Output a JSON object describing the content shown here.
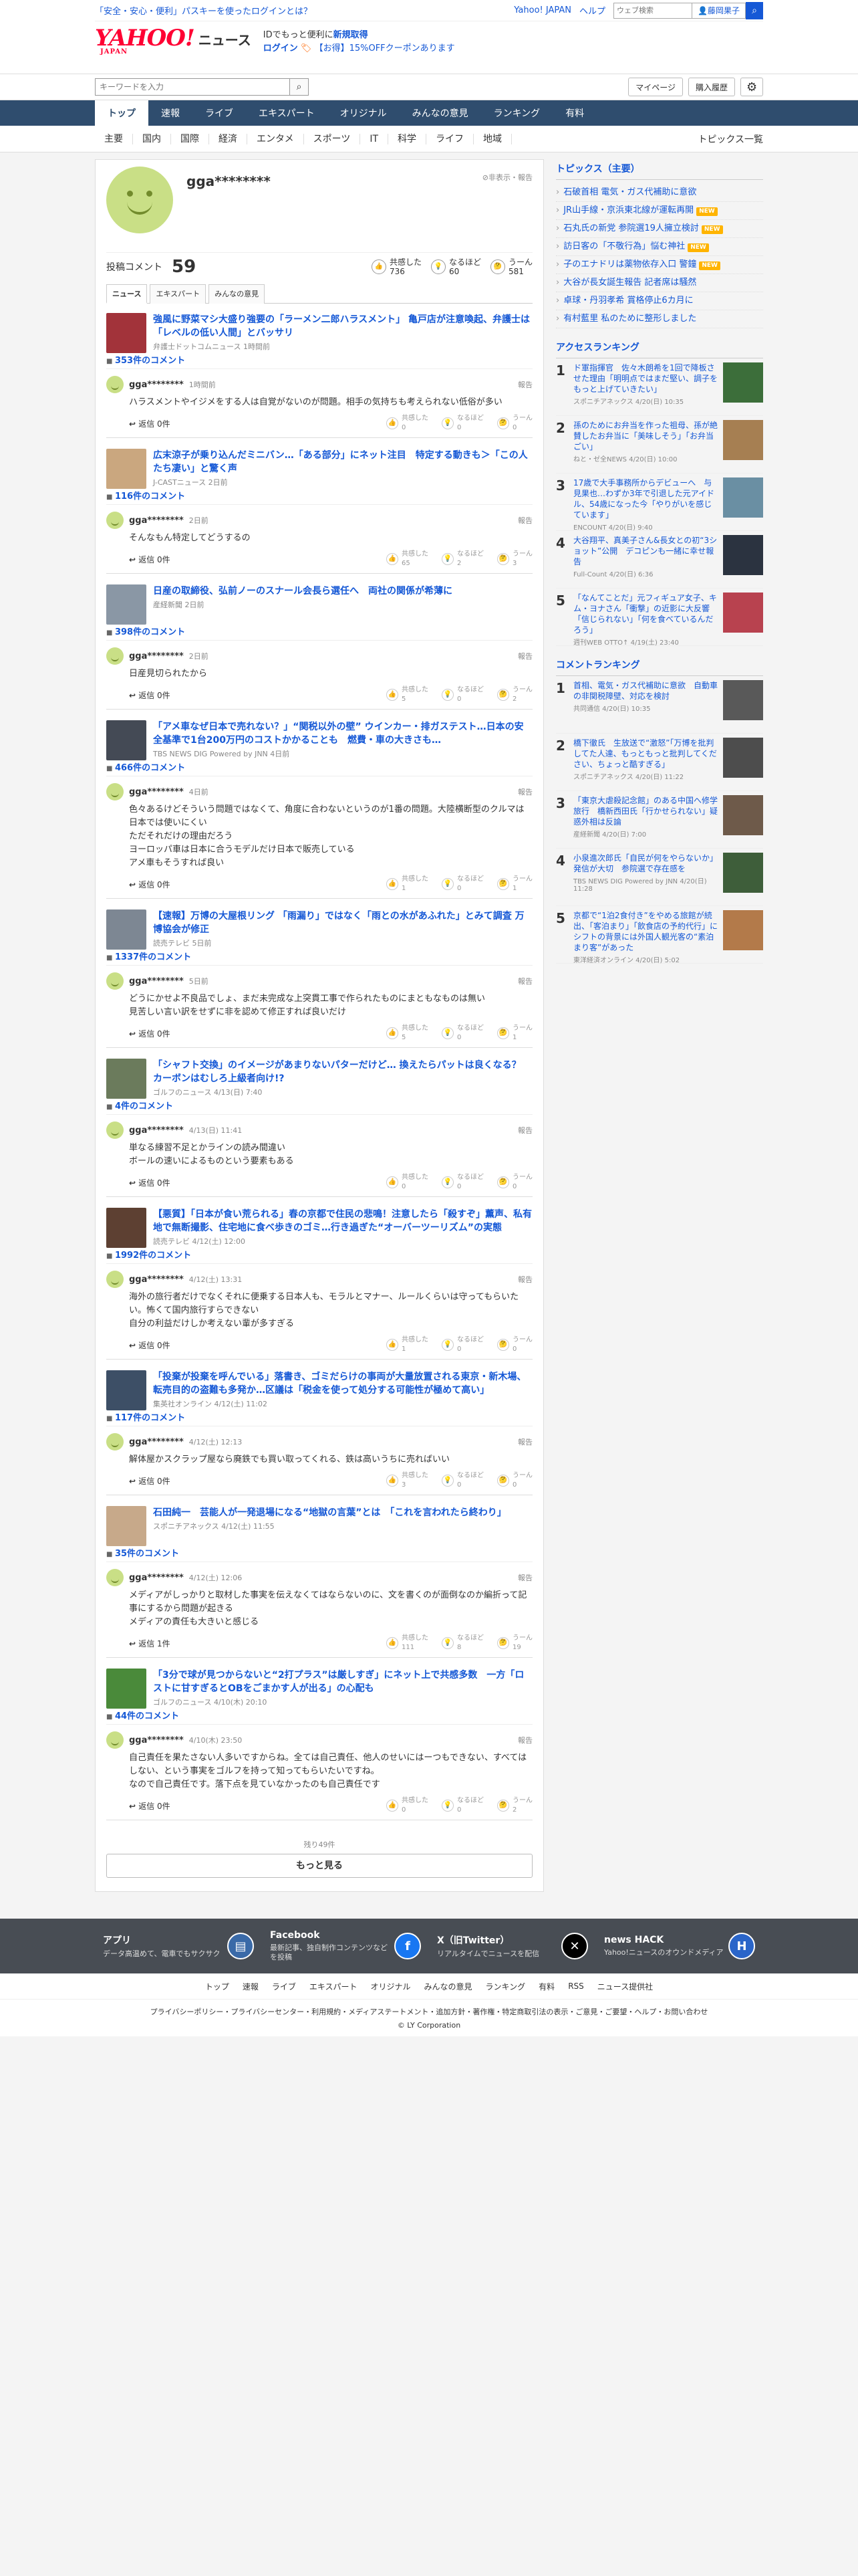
{
  "header": {
    "promo": "「安全・安心・便利」パスキーを使ったログインとは？",
    "links": [
      "Yahoo! JAPAN",
      "ヘルプ"
    ],
    "web_search_placeholder": "ウェブ検索",
    "user_button": "藤岡果子",
    "search_icon": "magnifier-icon",
    "logo_text": "YAHOO!",
    "logo_sub": "JAPAN",
    "news_title": "ニュース",
    "brand_msg": "IDでもっと便利に",
    "signup": "新規取得",
    "login": "ログイン",
    "coupon": "【お得】15%OFFクーポンあります"
  },
  "searchbar": {
    "placeholder": "キーワードを入力",
    "mypage": "マイページ",
    "history": "購入履歴",
    "gear": "gear-icon"
  },
  "nav": {
    "items": [
      "トップ",
      "速報",
      "ライブ",
      "エキスパート",
      "オリジナル",
      "みんなの意見",
      "ランキング",
      "有料"
    ],
    "active": 0
  },
  "subnav": {
    "items": [
      "主要",
      "国内",
      "国際",
      "経済",
      "エンタメ",
      "スポーツ",
      "IT",
      "科学",
      "ライフ",
      "地域"
    ],
    "right": "トピックス一覧"
  },
  "profile": {
    "name": "gga********",
    "report": "非表示・報告",
    "posts_label": "投稿コメント",
    "posts": "59",
    "reactions": [
      {
        "icon": "thumb-icon",
        "label": "共感した",
        "value": "736"
      },
      {
        "icon": "lightbulb-icon",
        "label": "なるほど",
        "value": "60"
      },
      {
        "icon": "thinking-icon",
        "label": "うーん",
        "value": "581"
      }
    ],
    "tabs": [
      "ニュース",
      "エキスパート",
      "みんなの意見"
    ]
  },
  "rx_labels": [
    "共感した",
    "なるほど",
    "うーん"
  ],
  "reply_label": "返信",
  "report_label": "報告",
  "items": [
    {
      "title": "強風に野菜マシ大盛り強要の「ラーメン二郎ハラスメント」 亀戸店が注意喚起、弁護士は「レベルの低い人間」とバッサリ",
      "src": "弁護士ドットコムニュース 1時間前",
      "count": "353件のコメント",
      "name": "gga********",
      "time": "1時間前",
      "text": "ハラスメントやイジメをする人は自覚がないのが問題。相手の気持ちも考えられない低俗が多い",
      "reply": "返信 0件",
      "r": [
        "0",
        "0",
        "0"
      ],
      "color": "#a2333a"
    },
    {
      "title": "広末涼子が乗り込んだミニバン…「ある部分」にネット注目　特定する動きも＞「この人たち凄い」と驚く声",
      "src": "J-CASTニュース 2日前",
      "count": "116件のコメント",
      "name": "gga********",
      "time": "2日前",
      "text": "そんなもん特定してどうするの",
      "reply": "返信 0件",
      "r": [
        "65",
        "2",
        "3"
      ],
      "color": "#caa77f"
    },
    {
      "title": "日産の取締役、弘前ノーのスナール会長ら選任へ　両社の関係が希薄に",
      "src": "産経新聞 2日前",
      "count": "398件のコメント",
      "name": "gga********",
      "time": "2日前",
      "text": "日産見切られたから",
      "reply": "返信 0件",
      "r": [
        "5",
        "0",
        "2"
      ],
      "color": "#8a97a5"
    },
    {
      "title": "「アメ車なぜ日本で売れない？」“関税以外の壁” ウインカー・排ガステスト…日本の安全基準で1台200万円のコストかかることも　燃費・車の大きさも…",
      "src": "TBS NEWS DIG Powered by JNN 4日前",
      "count": "466件のコメント",
      "name": "gga********",
      "time": "4日前",
      "text": "色々あるけどそういう問題ではなくて、角度に合わないというのが1番の問題。大陸横断型のクルマは日本では使いにくい\nただそれだけの理由だろう\nヨーロッパ車は日本に合うモデルだけ日本で販売している\nアメ車もそうすれば良い",
      "reply": "返信 0件",
      "r": [
        "1",
        "0",
        "1"
      ],
      "color": "#444a55"
    },
    {
      "title": "【速報】万博の大屋根リング 「雨漏り」ではなく「雨との水があふれた」とみて調査 万博協会が修正",
      "src": "読売テレビ 5日前",
      "count": "1337件のコメント",
      "name": "gga********",
      "time": "5日前",
      "text": "どうにかせよ不良品でしょ、まだ未完成な上突貫工事で作られたものにまともなものは無い\n見苦しい言い訳をせずに非を認めて修正すれば良いだけ",
      "reply": "返信 0件",
      "r": [
        "5",
        "0",
        "1"
      ],
      "color": "#7d8793"
    },
    {
      "title": "「シャフト交換」のイメージがあまりないパターだけど… 換えたらパットは良くなる？ カーボンはむしろ上級者向け!?",
      "src": "ゴルフのニュース 4/13(日) 7:40",
      "count": "4件のコメント",
      "name": "gga********",
      "time": "4/13(日) 11:41",
      "text": "単なる練習不足とかラインの読み間違い\nボールの速いによるものという要素もある",
      "reply": "返信 0件",
      "r": [
        "0",
        "0",
        "0"
      ],
      "color": "#6b7b5c"
    },
    {
      "title": "【悪質】「日本が食い荒られる」春の京都で住民の悲鳴！注意したら「殺すぞ」薫声、私有地で無断撮影、住宅地に食べ歩きのゴミ…行き過ぎた“オーバーツーリズム”の実態",
      "src": "読売テレビ 4/12(土) 12:00",
      "count": "1992件のコメント",
      "name": "gga********",
      "time": "4/12(土) 13:31",
      "text": "海外の旅行者だけでなくそれに便乗する日本人も、モラルとマナー、ルールくらいは守ってもらいたい。怖くて国内旅行すらできない\n自分の利益だけしか考えない輩が多すぎる",
      "reply": "返信 0件",
      "r": [
        "1",
        "0",
        "0"
      ],
      "color": "#5d4032"
    },
    {
      "title": "「投棄が投棄を呼んでいる」落書き、ゴミだらけの事両が大量放置される東京・新木場、転売目的の盗難も多発か…区議は「税金を使って処分する可能性が極めて高い」",
      "src": "集英社オンライン 4/12(土) 11:02",
      "count": "117件のコメント",
      "name": "gga********",
      "time": "4/12(土) 12:13",
      "text": "解体屋かスクラップ屋なら廃鉄でも買い取ってくれる、鉄は高いうちに売ればいい",
      "reply": "返信 0件",
      "r": [
        "3",
        "0",
        "0"
      ],
      "color": "#3d4f66"
    },
    {
      "title": "石田純一　芸能人が一発退場になる“地獄の言葉”とは　「これを言われたら終わり」",
      "src": "スポニチアネックス 4/12(土) 11:55",
      "count": "35件のコメント",
      "name": "gga********",
      "time": "4/12(土) 12:06",
      "text": "メディアがしっかりと取材した事実を伝えなくてはならないのに、文を書くのが面倒なのか編折って記事にするから問題が起きる\nメディアの責任も大きいと感じる",
      "reply": "返信 1件",
      "r": [
        "111",
        "8",
        "19"
      ],
      "color": "#c7a98a"
    },
    {
      "title": "「3分で球が見つからないと“2打プラス”は厳しすぎ」にネット上で共感多数　一方「ロストに甘すぎるとOBをごまかす人が出る」の心配も",
      "src": "ゴルフのニュース 4/10(木) 20:10",
      "count": "44件のコメント",
      "name": "gga********",
      "time": "4/10(木) 23:50",
      "text": "自己責任を果たさない人多いですからね。全ては自己責任、他人のせいにはーつもできない、すべてはしない、という事実をゴルフを持って知ってもらいたいですね。\nなので自己責任です。落下点を見ていなかったのも自己責任です",
      "reply": "返信 0件",
      "r": [
        "0",
        "0",
        "2"
      ],
      "color": "#4a8a3a"
    }
  ],
  "more": {
    "remain": "残り49件",
    "label": "もっと見る"
  },
  "topics": {
    "title": "トピックス（主要）",
    "items": [
      {
        "t": "石破首相 電気・ガス代補助に意欲",
        "b": ""
      },
      {
        "t": "JR山手線・京浜東北線が運転再開",
        "b": "NEW"
      },
      {
        "t": "石丸氏の新党 参院選19人擁立検討",
        "b": "NEW"
      },
      {
        "t": "訪日客の「不敬行為」悩む神社",
        "b": "NEW"
      },
      {
        "t": "子のエナドリは薬物依存入口 警鐘",
        "b": "NEW"
      },
      {
        "t": "大谷が長女誕生報告 記者席は騒然",
        "b": ""
      },
      {
        "t": "卓球・丹羽孝希 賞格停止6カ月に",
        "b": ""
      },
      {
        "t": "有村藍里 私のために整形しました",
        "b": ""
      }
    ]
  },
  "access": {
    "title": "アクセスランキング",
    "items": [
      {
        "n": "1",
        "t": "ド軍指揮官　佐々木朗希を1回で降板させた理由「明明点ではまだ堅い、調子をもっと上げていきたい」",
        "s": "スポニチアネックス 4/20(日) 10:35",
        "c": "#3c6e3a"
      },
      {
        "n": "2",
        "t": "孫のためにお弁当を作った祖母、孫が絶賛したお弁当に「美味しそう」「お弁当ごい」",
        "s": "ねと・ゼ全NEWS 4/20(日) 10:00",
        "c": "#a67f52"
      },
      {
        "n": "3",
        "t": "17歳で大手事務所からデビューへ　与見果也…わずか3年で引退した元アイドル、54歳になった今「やりがいを感じています」",
        "s": "ENCOUNT 4/20(日) 9:40",
        "c": "#6a8fa3"
      },
      {
        "n": "4",
        "t": "大谷翔平、真美子さん&長女との初“3ショット”公開　デコピンも一緒に幸せ報告",
        "s": "Full-Count 4/20(日) 6:36",
        "c": "#2b3340"
      },
      {
        "n": "5",
        "t": "「なんてことだ」元フィギュア女子、キム・ヨナさん「衝撃」の近影に大反響「信じられない」「何を食べているんだろう」",
        "s": "週刊WEB OTTO↑ 4/19(土) 23:40",
        "c": "#b8424f"
      }
    ]
  },
  "commentrank": {
    "title": "コメントランキング",
    "items": [
      {
        "n": "1",
        "t": "首相、電気・ガス代補助に意欲　自動車の非関税障壁、対応を検討",
        "s": "共同通信 4/20(日) 10:35",
        "c": "#595959"
      },
      {
        "n": "2",
        "t": "橋下徹氏　生放送で“激怒”「万博を批判してた人達、もっともっと批判してください、ちょっと酷すぎる」",
        "s": "スポニチアネックス 4/20(日) 11:22",
        "c": "#4d4d4d"
      },
      {
        "n": "3",
        "t": "「東京大虐殺記念館」のある中国へ修学旅行　橋新西田氏「行かせられない」疑惑外相は反論",
        "s": "産経新聞 4/20(日) 7:00",
        "c": "#6e5a4a"
      },
      {
        "n": "4",
        "t": "小泉進次郎氏「自民が何をやらないか」発信が大切　参院選で存在感を",
        "s": "TBS NEWS DIG Powered by JNN 4/20(日) 11:28",
        "c": "#3e5e3a"
      },
      {
        "n": "5",
        "t": "京都で“1泊2食付き”をやめる旅館が続出、「客泊まり」「飲食店の予約代行」にシフトの背景には外国人観光客の“素泊まり客”があった",
        "s": "東洋経済オンライン 4/20(日) 5:02",
        "c": "#b37a4a"
      }
    ]
  },
  "footer_bar": [
    {
      "name": "アプリ",
      "desc": "データ高温めて、電車でもサクサク",
      "icon": "app-icon",
      "c": "#3a6aa8",
      "g": "▤"
    },
    {
      "name": "Facebook",
      "desc": "最新記事、独自制作コンテンツなどを投稿",
      "icon": "facebook-icon",
      "c": "#1877f2",
      "g": "f"
    },
    {
      "name": "X（旧Twitter）",
      "desc": "リアルタイムでニュースを配信",
      "icon": "x-icon",
      "c": "#000000",
      "g": "✕"
    },
    {
      "name": "news HACK",
      "desc": "Yahoo!ニュースのオウンドメディア",
      "icon": "hack-icon",
      "c": "#2a65c9",
      "g": "H"
    }
  ],
  "footer_links": [
    "トップ",
    "速報",
    "ライブ",
    "エキスパート",
    "オリジナル",
    "みんなの意見",
    "ランキング",
    "有料",
    "RSS",
    "ニュース提供社"
  ],
  "footer_policy": "プライバシーポリシー・プライバシーセンター・利用規約・メディアステートメント・追加方針・著作権・特定商取引法の表示・ご意見・ご要望・ヘルプ・お問い合わせ",
  "copyright": "© LY Corporation"
}
